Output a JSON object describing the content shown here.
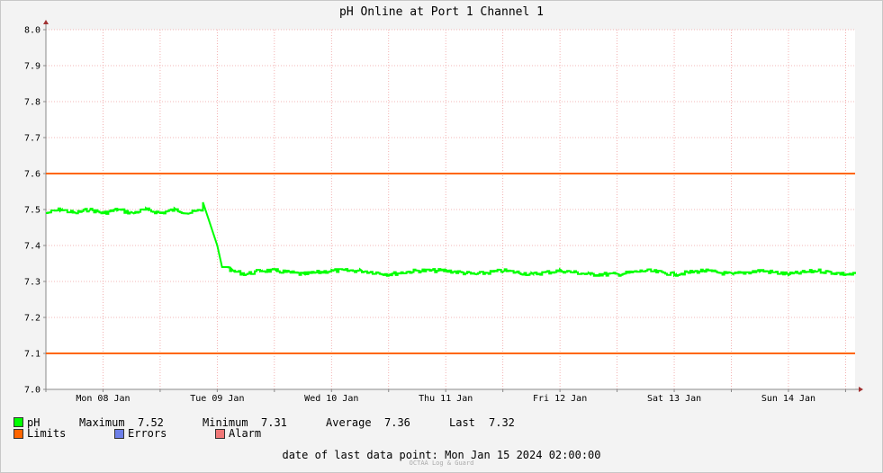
{
  "chart_data": {
    "type": "line",
    "title": "pH Online at Port 1 Channel 1",
    "ylim": [
      7.0,
      8.0
    ],
    "y_ticks": [
      "7.0",
      "7.1",
      "7.2",
      "7.3",
      "7.4",
      "7.5",
      "7.6",
      "7.7",
      "7.8",
      "7.9",
      "8.0"
    ],
    "x_labels": [
      "Mon 08 Jan",
      "Tue 09 Jan",
      "Wed 10 Jan",
      "Thu 11 Jan",
      "Fri 12 Jan",
      "Sat 13 Jan",
      "Sun 14 Jan"
    ],
    "x_start": "Mon 08 Jan 2024 00:00",
    "x_end": "Mon 15 Jan 2024 02:00",
    "grid": true,
    "series": [
      {
        "name": "pH",
        "color": "#00ff00",
        "x": [
          "Mon 08 Jan 00:00",
          "Mon 08 Jan 03:00",
          "Mon 08 Jan 06:00",
          "Mon 08 Jan 09:00",
          "Mon 08 Jan 12:00",
          "Mon 08 Jan 15:00",
          "Mon 08 Jan 18:00",
          "Mon 08 Jan 21:00",
          "Tue 09 Jan 00:00",
          "Tue 09 Jan 03:00",
          "Tue 09 Jan 06:00",
          "Tue 09 Jan 09:00",
          "Tue 09 Jan 12:00",
          "Tue 09 Jan 13:00",
          "Tue 09 Jan 14:00",
          "Tue 09 Jan 15:00",
          "Tue 09 Jan 18:00",
          "Tue 09 Jan 21:00",
          "Wed 10 Jan 00:00",
          "Wed 10 Jan 06:00",
          "Wed 10 Jan 12:00",
          "Wed 10 Jan 18:00",
          "Thu 11 Jan 00:00",
          "Thu 11 Jan 06:00",
          "Thu 11 Jan 12:00",
          "Thu 11 Jan 18:00",
          "Fri 12 Jan 00:00",
          "Fri 12 Jan 06:00",
          "Fri 12 Jan 12:00",
          "Fri 12 Jan 18:00",
          "Sat 13 Jan 00:00",
          "Sat 13 Jan 06:00",
          "Sat 13 Jan 12:00",
          "Sat 13 Jan 18:00",
          "Sun 14 Jan 00:00",
          "Sun 14 Jan 06:00",
          "Sun 14 Jan 12:00",
          "Sun 14 Jan 18:00",
          "Mon 15 Jan 00:00",
          "Mon 15 Jan 02:00"
        ],
        "values": [
          7.49,
          7.5,
          7.49,
          7.5,
          7.49,
          7.5,
          7.49,
          7.5,
          7.49,
          7.5,
          7.49,
          7.5,
          7.52,
          7.4,
          7.34,
          7.33,
          7.32,
          7.33,
          7.33,
          7.32,
          7.33,
          7.33,
          7.32,
          7.33,
          7.33,
          7.32,
          7.33,
          7.32,
          7.33,
          7.32,
          7.32,
          7.33,
          7.32,
          7.33,
          7.32,
          7.33,
          7.32,
          7.33,
          7.32,
          7.32
        ]
      },
      {
        "name": "Limits",
        "color": "#ff6600",
        "values": [
          7.1,
          7.6
        ]
      }
    ]
  },
  "legend": {
    "ph_label": "pH",
    "max_label": "Maximum",
    "max_value": "7.52",
    "min_label": "Minimum",
    "min_value": "7.31",
    "avg_label": "Average",
    "avg_value": "7.36",
    "last_label": "Last",
    "last_value": "7.32",
    "limits_label": "Limits",
    "errors_label": "Errors",
    "alarm_label": "Alarm",
    "colors": {
      "ph": "#00ff00",
      "limits": "#ff6600",
      "errors": "#6d7fe8",
      "alarm": "#f07878"
    }
  },
  "footer": {
    "text": "date of last data point:  Mon Jan 15 2024 02:00:00",
    "credit": "OCTAA Log & Guard"
  }
}
